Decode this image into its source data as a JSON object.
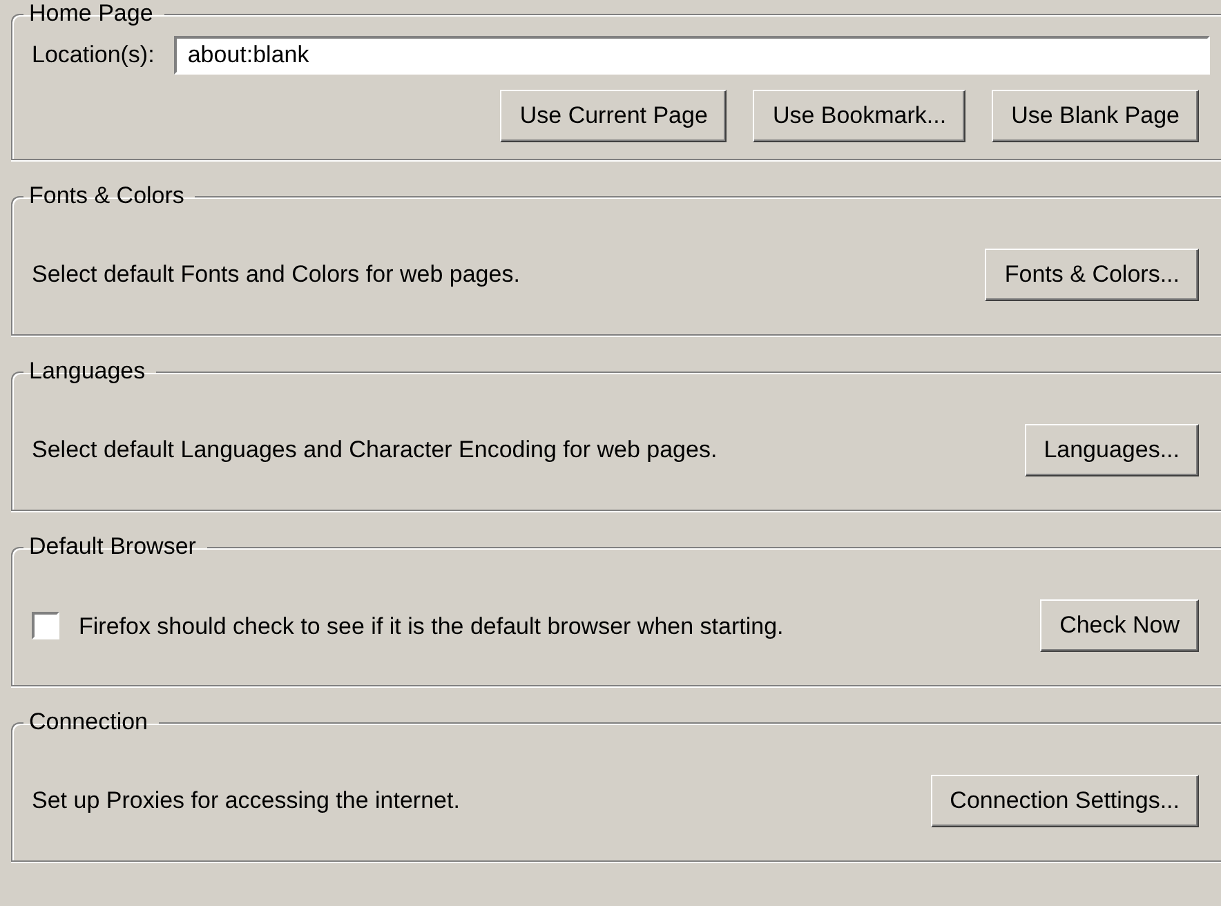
{
  "home_page": {
    "title": "Home Page",
    "location_label": "Location(s):",
    "location_value": "about:blank",
    "buttons": [
      "Use Current Page",
      "Use Bookmark...",
      "Use Blank Page"
    ]
  },
  "sections": [
    {
      "kind": "text",
      "title": "Fonts & Colors",
      "description": "Select default Fonts and Colors for web pages.",
      "button": "Fonts & Colors..."
    },
    {
      "kind": "text",
      "title": "Languages",
      "description": "Select default Languages and Character Encoding for web pages.",
      "button": "Languages..."
    },
    {
      "kind": "checkbox",
      "title": "Default Browser",
      "description": "Firefox should check to see if it is the default browser when starting.",
      "checked": false,
      "button": "Check Now"
    },
    {
      "kind": "text",
      "title": "Connection",
      "description": "Set up Proxies for accessing the internet.",
      "button": "Connection Settings..."
    }
  ]
}
